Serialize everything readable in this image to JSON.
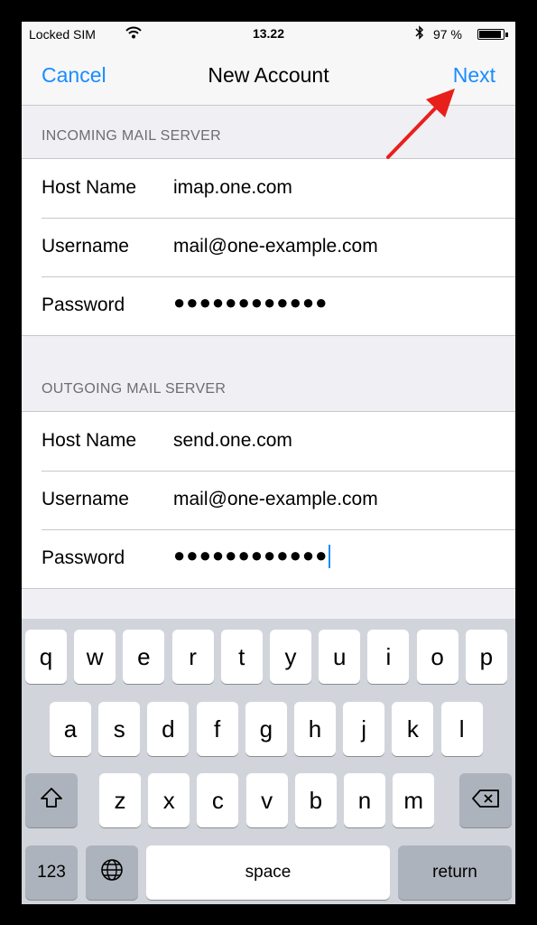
{
  "status": {
    "carrier": "Locked SIM",
    "time": "13.22",
    "battery_percent": "97 %",
    "battery_level": 0.97
  },
  "nav": {
    "cancel_label": "Cancel",
    "title": "New Account",
    "next_label": "Next"
  },
  "incoming": {
    "header": "INCOMING MAIL SERVER",
    "host_label": "Host Name",
    "host_value": "imap.one.com",
    "user_label": "Username",
    "user_value": "mail@one-example.com",
    "pass_label": "Password",
    "pass_value": "●●●●●●●●●●●●"
  },
  "outgoing": {
    "header": "OUTGOING MAIL SERVER",
    "host_label": "Host Name",
    "host_value": "send.one.com",
    "user_label": "Username",
    "user_value": "mail@one-example.com",
    "pass_label": "Password",
    "pass_value": "●●●●●●●●●●●●"
  },
  "keyboard": {
    "row1": [
      "q",
      "w",
      "e",
      "r",
      "t",
      "y",
      "u",
      "i",
      "o",
      "p"
    ],
    "row2": [
      "a",
      "s",
      "d",
      "f",
      "g",
      "h",
      "j",
      "k",
      "l"
    ],
    "row3": [
      "z",
      "x",
      "c",
      "v",
      "b",
      "n",
      "m"
    ],
    "numbers_label": "123",
    "space_label": "space",
    "return_label": "return"
  },
  "colors": {
    "accent": "#1a8cff",
    "arrow": "#e8201c"
  },
  "icons": [
    "wifi-icon",
    "bluetooth-icon",
    "battery-icon",
    "shift-icon",
    "backspace-icon",
    "globe-icon",
    "arrow-annotation-icon"
  ]
}
